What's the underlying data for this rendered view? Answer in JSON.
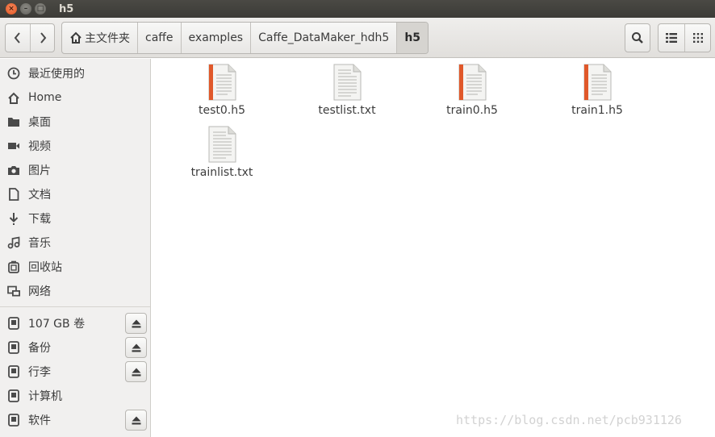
{
  "window": {
    "title": "h5",
    "buttons": {
      "close": "×",
      "minimize": "–",
      "maximize": "□"
    }
  },
  "toolbar": {
    "back_icon": "chevron-left-icon",
    "forward_icon": "chevron-right-icon",
    "breadcrumbs": [
      {
        "label": "主文件夹",
        "icon": "home-icon"
      },
      {
        "label": "caffe"
      },
      {
        "label": "examples"
      },
      {
        "label": "Caffe_DataMaker_hdh5"
      },
      {
        "label": "h5"
      }
    ],
    "search_icon": "search-icon",
    "list_view_icon": "list-view-icon",
    "grid_view_icon": "grid-view-icon"
  },
  "sidebar": {
    "places": [
      {
        "label": "最近使用的",
        "icon": "clock-icon"
      },
      {
        "label": "Home",
        "icon": "home-icon"
      },
      {
        "label": "桌面",
        "icon": "folder-icon"
      },
      {
        "label": "视频",
        "icon": "video-icon"
      },
      {
        "label": "图片",
        "icon": "camera-icon"
      },
      {
        "label": "文档",
        "icon": "document-icon"
      },
      {
        "label": "下载",
        "icon": "download-icon"
      },
      {
        "label": "音乐",
        "icon": "music-icon"
      },
      {
        "label": "回收站",
        "icon": "trash-icon"
      },
      {
        "label": "网络",
        "icon": "network-icon"
      }
    ],
    "devices": [
      {
        "label": "107 GB 卷",
        "icon": "drive-icon",
        "eject": true
      },
      {
        "label": "备份",
        "icon": "drive-icon",
        "eject": true
      },
      {
        "label": "行李",
        "icon": "drive-icon",
        "eject": true
      },
      {
        "label": "计算机",
        "icon": "drive-icon",
        "eject": false
      },
      {
        "label": "软件",
        "icon": "drive-icon",
        "eject": true
      }
    ]
  },
  "files": [
    {
      "name": "test0.h5",
      "icon": "h5-file-icon"
    },
    {
      "name": "testlist.txt",
      "icon": "text-file-icon"
    },
    {
      "name": "train0.h5",
      "icon": "h5-file-icon"
    },
    {
      "name": "train1.h5",
      "icon": "h5-file-icon"
    },
    {
      "name": "trainlist.txt",
      "icon": "text-file-icon"
    }
  ],
  "watermark": "https://blog.csdn.net/pcb931126",
  "colors": {
    "accent_close": "#e3531e",
    "titlebar": "#3c3b37",
    "toolbar": "#e8e7e5",
    "sidebar": "#f1f0ef",
    "h5_stripe": "#e0582a"
  }
}
